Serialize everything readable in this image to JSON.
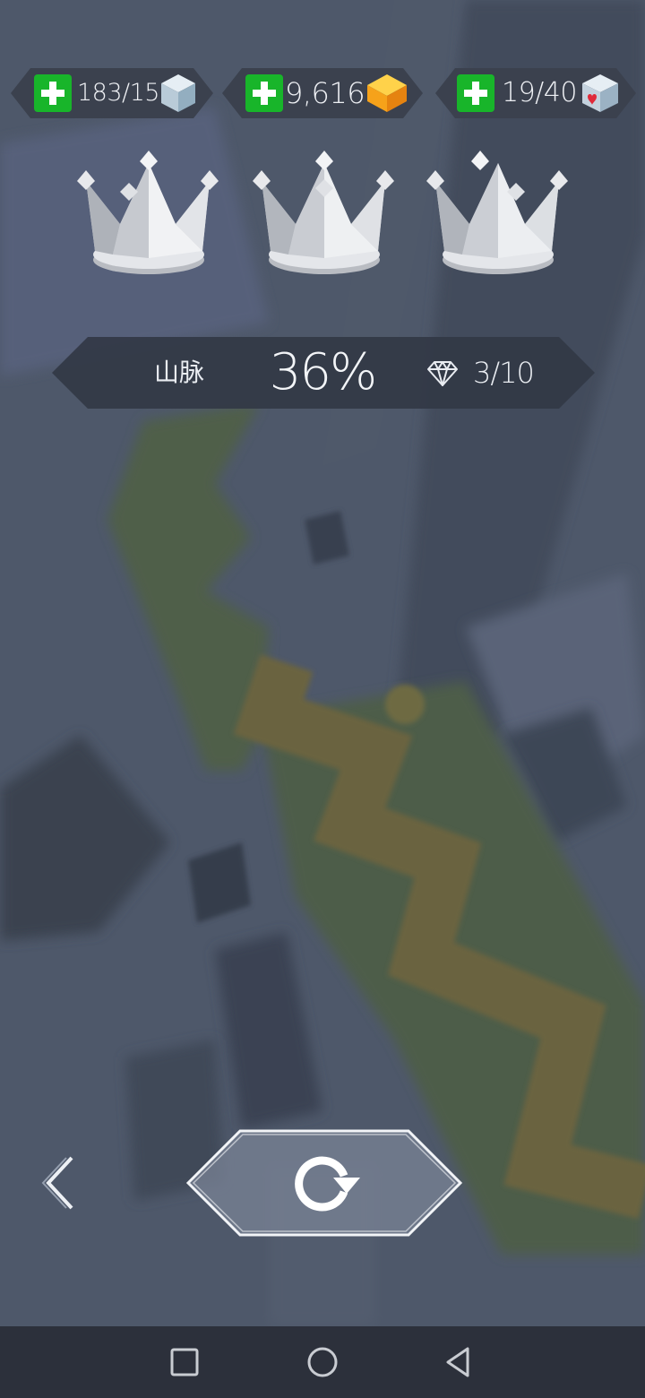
{
  "currencies": [
    {
      "id": "cubes",
      "value": "183/15",
      "icon": "ice-cube-icon"
    },
    {
      "id": "coins",
      "value": "9,616",
      "icon": "gold-cube-icon"
    },
    {
      "id": "lives",
      "value": "19/40",
      "icon": "heart-cube-icon"
    }
  ],
  "crowns": [
    {
      "state": "silver",
      "earned": true
    },
    {
      "state": "silver",
      "earned": true
    },
    {
      "state": "silver",
      "earned": true
    }
  ],
  "level": {
    "name": "山脉",
    "progress": "36%",
    "progress_fraction": 0.36,
    "gems": "3/10",
    "gem_icon": "diamond-icon"
  },
  "controls": {
    "back_icon": "chevron-left-icon",
    "retry_icon": "retry-icon"
  },
  "nav": {
    "recents_icon": "square-icon",
    "home_icon": "circle-icon",
    "back_icon": "triangle-back-icon"
  },
  "colors": {
    "plus_green": "#18b52a",
    "path_yellow": "#6a6440",
    "path_green": "#4f5f4a",
    "background": "#4e586a"
  }
}
